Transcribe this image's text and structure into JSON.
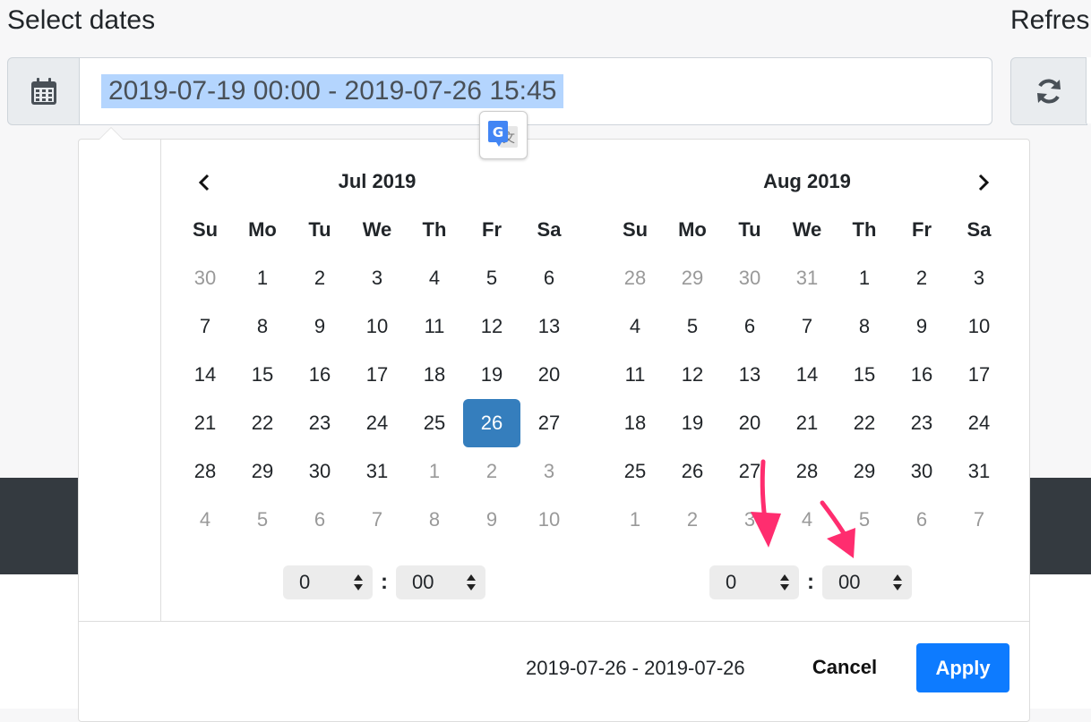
{
  "labels": {
    "select_dates": "Select dates",
    "refresh": "Refres"
  },
  "date_input": {
    "value": "2019-07-19 00:00 - 2019-07-26 15:45"
  },
  "icons": {
    "addon": "calendar-icon",
    "refresh": "refresh-icon",
    "translate": "google-translate-icon"
  },
  "calendars": [
    {
      "month": "Jul 2019",
      "weekdays": [
        "Su",
        "Mo",
        "Tu",
        "We",
        "Th",
        "Fr",
        "Sa"
      ],
      "weeks": [
        [
          {
            "d": "30",
            "off": true
          },
          {
            "d": "1"
          },
          {
            "d": "2"
          },
          {
            "d": "3"
          },
          {
            "d": "4"
          },
          {
            "d": "5"
          },
          {
            "d": "6"
          }
        ],
        [
          {
            "d": "7"
          },
          {
            "d": "8"
          },
          {
            "d": "9"
          },
          {
            "d": "10"
          },
          {
            "d": "11"
          },
          {
            "d": "12"
          },
          {
            "d": "13"
          }
        ],
        [
          {
            "d": "14"
          },
          {
            "d": "15"
          },
          {
            "d": "16"
          },
          {
            "d": "17"
          },
          {
            "d": "18"
          },
          {
            "d": "19"
          },
          {
            "d": "20"
          }
        ],
        [
          {
            "d": "21"
          },
          {
            "d": "22"
          },
          {
            "d": "23"
          },
          {
            "d": "24"
          },
          {
            "d": "25"
          },
          {
            "d": "26",
            "active": true
          },
          {
            "d": "27"
          }
        ],
        [
          {
            "d": "28"
          },
          {
            "d": "29"
          },
          {
            "d": "30"
          },
          {
            "d": "31"
          },
          {
            "d": "1",
            "off": true
          },
          {
            "d": "2",
            "off": true
          },
          {
            "d": "3",
            "off": true
          }
        ],
        [
          {
            "d": "4",
            "off": true
          },
          {
            "d": "5",
            "off": true
          },
          {
            "d": "6",
            "off": true
          },
          {
            "d": "7",
            "off": true
          },
          {
            "d": "8",
            "off": true
          },
          {
            "d": "9",
            "off": true
          },
          {
            "d": "10",
            "off": true
          }
        ]
      ],
      "hour": "0",
      "minute": "00"
    },
    {
      "month": "Aug 2019",
      "weekdays": [
        "Su",
        "Mo",
        "Tu",
        "We",
        "Th",
        "Fr",
        "Sa"
      ],
      "weeks": [
        [
          {
            "d": "28",
            "off": true
          },
          {
            "d": "29",
            "off": true
          },
          {
            "d": "30",
            "off": true
          },
          {
            "d": "31",
            "off": true
          },
          {
            "d": "1"
          },
          {
            "d": "2"
          },
          {
            "d": "3"
          }
        ],
        [
          {
            "d": "4"
          },
          {
            "d": "5"
          },
          {
            "d": "6"
          },
          {
            "d": "7"
          },
          {
            "d": "8"
          },
          {
            "d": "9"
          },
          {
            "d": "10"
          }
        ],
        [
          {
            "d": "11"
          },
          {
            "d": "12"
          },
          {
            "d": "13"
          },
          {
            "d": "14"
          },
          {
            "d": "15"
          },
          {
            "d": "16"
          },
          {
            "d": "17"
          }
        ],
        [
          {
            "d": "18"
          },
          {
            "d": "19"
          },
          {
            "d": "20"
          },
          {
            "d": "21"
          },
          {
            "d": "22"
          },
          {
            "d": "23"
          },
          {
            "d": "24"
          }
        ],
        [
          {
            "d": "25"
          },
          {
            "d": "26"
          },
          {
            "d": "27"
          },
          {
            "d": "28"
          },
          {
            "d": "29"
          },
          {
            "d": "30"
          },
          {
            "d": "31"
          }
        ],
        [
          {
            "d": "1",
            "off": true
          },
          {
            "d": "2",
            "off": true
          },
          {
            "d": "3",
            "off": true
          },
          {
            "d": "4",
            "off": true
          },
          {
            "d": "5",
            "off": true
          },
          {
            "d": "6",
            "off": true
          },
          {
            "d": "7",
            "off": true
          }
        ]
      ],
      "hour": "0",
      "minute": "00"
    }
  ],
  "footer": {
    "selected_range": "2019-07-26 - 2019-07-26",
    "cancel": "Cancel",
    "apply": "Apply"
  },
  "colors": {
    "active_day": "#357ebd",
    "apply": "#0d7bff",
    "annotation_arrow": "#ff2d6f",
    "input_highlight": "#b4d5fe"
  }
}
